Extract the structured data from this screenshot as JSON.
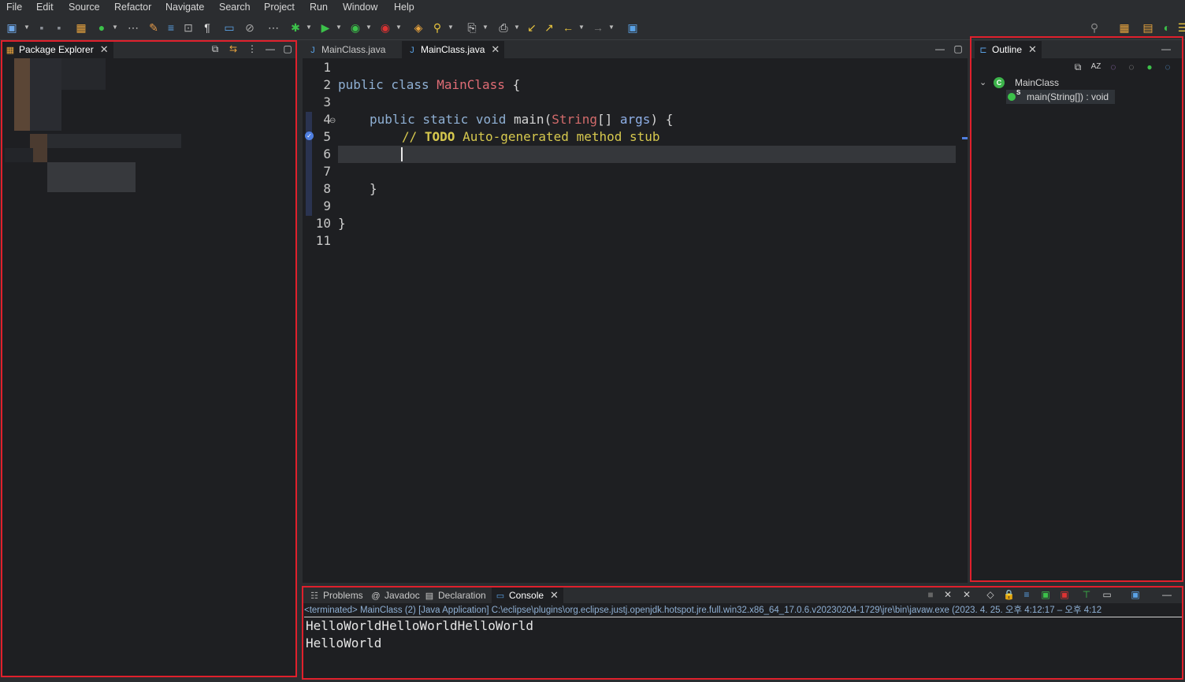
{
  "menu": [
    "File",
    "Edit",
    "Source",
    "Refactor",
    "Navigate",
    "Search",
    "Project",
    "Run",
    "Window",
    "Help"
  ],
  "package_explorer": {
    "tab_label": "Package Explorer"
  },
  "editor": {
    "tabs": [
      {
        "label": "MainClass.java",
        "active": false
      },
      {
        "label": "MainClass.java",
        "active": true
      }
    ],
    "line_numbers": [
      "1",
      "2",
      "3",
      "4",
      "5",
      "6",
      "7",
      "8",
      "9",
      "10",
      "11"
    ],
    "code": {
      "l2_kw": "public class ",
      "l2_cls": "MainClass",
      "l2_rest": " {",
      "l4_kw": "public static void ",
      "l4_name": "main(",
      "l4_type": "String",
      "l4_arr": "[] ",
      "l4_param": "args",
      "l4_rest": ") {",
      "l5_slashes": "// ",
      "l5_todo": "TODO",
      "l5_comment": " Auto-generated method stub",
      "l8": "}",
      "l10": "}"
    }
  },
  "outline": {
    "tab_label": "Outline",
    "class_name": "MainClass",
    "method": "main(String[]) : void",
    "method_badge": "S"
  },
  "bottom": {
    "tabs": [
      {
        "label": "Problems",
        "icon": "problems-icon"
      },
      {
        "label": "Javadoc",
        "icon": "javadoc-icon"
      },
      {
        "label": "Declaration",
        "icon": "declaration-icon"
      },
      {
        "label": "Console",
        "icon": "console-icon"
      }
    ],
    "console_header": "<terminated> MainClass (2) [Java Application] C:\\eclipse\\plugins\\org.eclipse.justj.openjdk.hotspot.jre.full.win32.x86_64_17.0.6.v20230204-1729\\jre\\bin\\javaw.exe  (2023. 4. 25. 오후 4:12:17 – 오후 4:12",
    "output": [
      "HelloWorldHelloWorldHelloWorld",
      "HelloWorld"
    ]
  },
  "colors": {
    "highlight_box": "#e0202c",
    "background": "#1e1f22",
    "chrome": "#2b2d30"
  }
}
